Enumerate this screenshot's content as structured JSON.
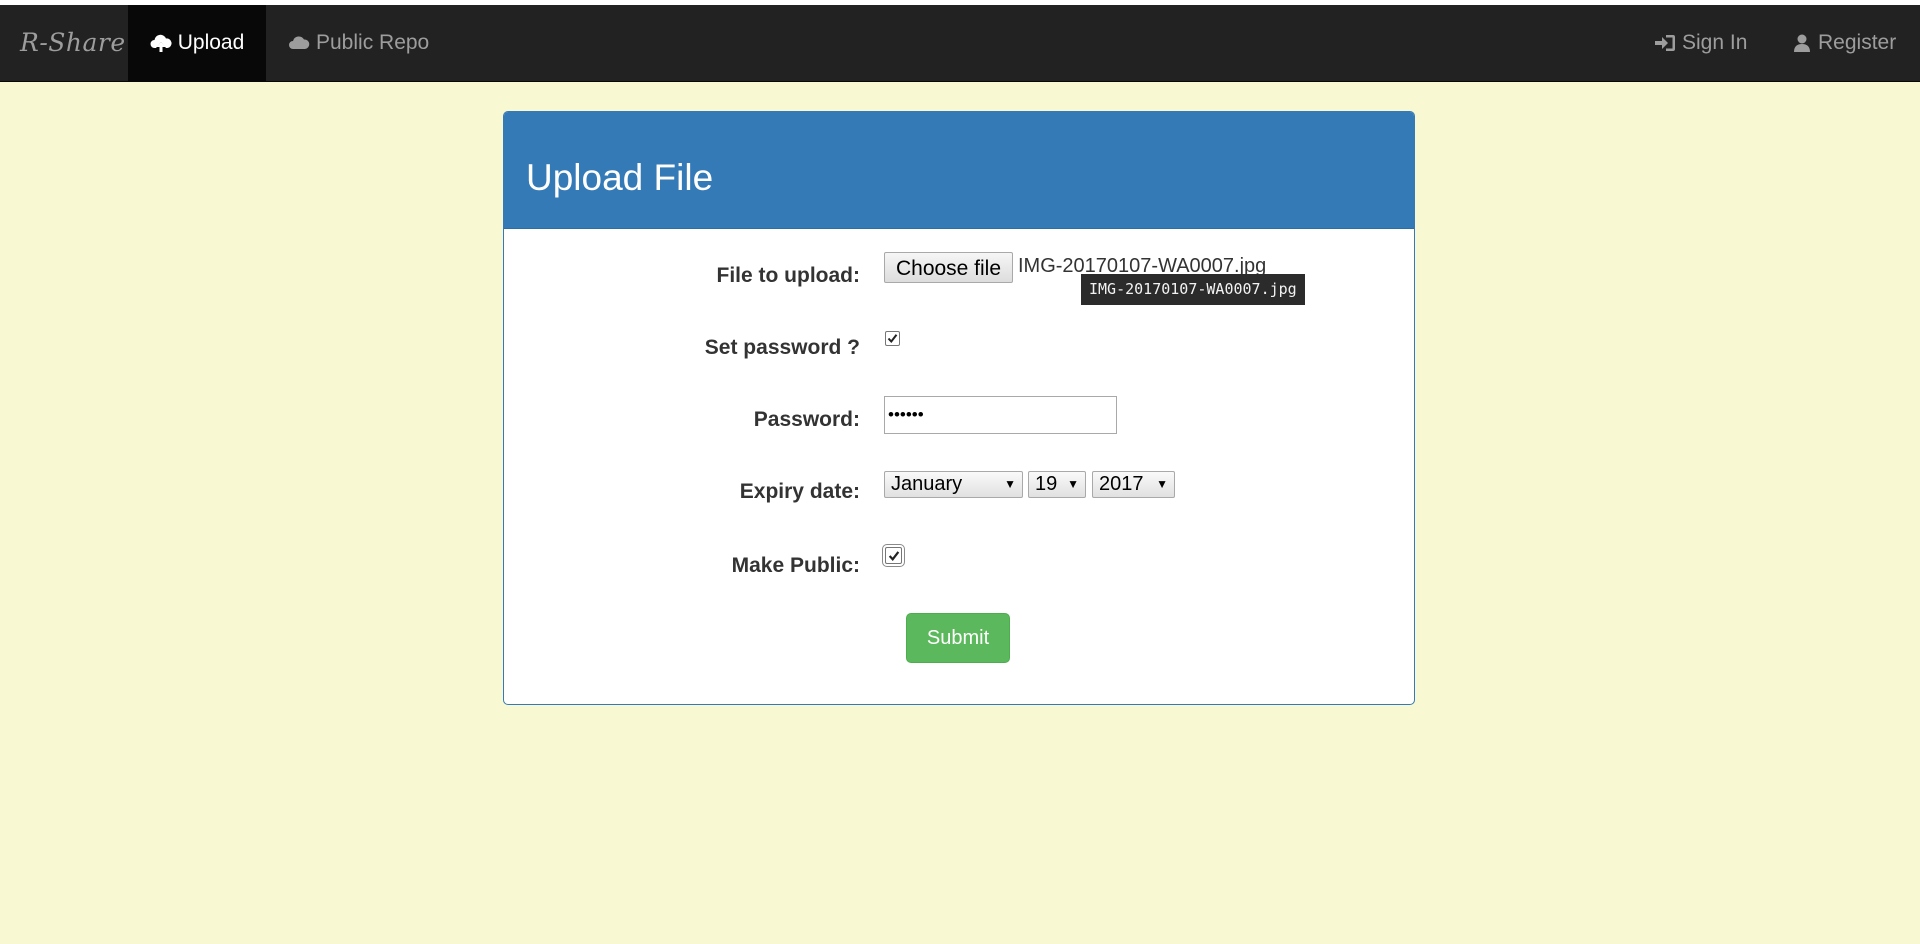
{
  "navbar": {
    "brand": "R-Share",
    "items": [
      {
        "label": "Upload",
        "icon": "cloud-upload-icon",
        "active": true
      },
      {
        "label": "Public Repo",
        "icon": "cloud-icon",
        "active": false
      }
    ],
    "right_items": [
      {
        "label": "Sign In",
        "icon": "log-in-icon"
      },
      {
        "label": "Register",
        "icon": "user-icon"
      }
    ]
  },
  "panel": {
    "title": "Upload File"
  },
  "form": {
    "file_label": "File to upload:",
    "file_button": "Choose file",
    "file_name": "IMG-20170107-WA0007.jpg",
    "file_tooltip": "IMG-20170107-WA0007.jpg",
    "set_password_label": "Set password ?",
    "set_password_checked": true,
    "password_label": "Password:",
    "password_value": "••••••",
    "expiry_label": "Expiry date:",
    "expiry_month": "January",
    "expiry_day": "19",
    "expiry_year": "2017",
    "make_public_label": "Make Public:",
    "make_public_checked": true,
    "submit_label": "Submit"
  },
  "colors": {
    "background": "#f8f9d2",
    "navbar": "#222222",
    "panel_primary": "#337ab7",
    "success": "#5cb85c"
  }
}
